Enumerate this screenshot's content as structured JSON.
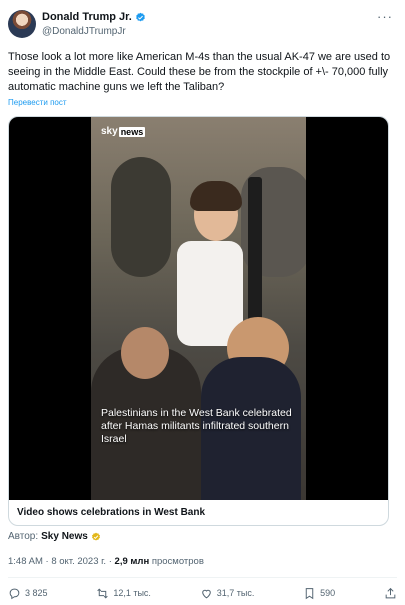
{
  "author": {
    "display_name": "Donald Trump Jr.",
    "handle": "@DonaldJTrumpJr"
  },
  "tweet": {
    "text": "Those look a lot more like American M-4s than the usual AK-47 we are used to seeing in the Middle East. Could these be from the stockpile of +\\- 70,000 fully automatic machine guns we left the Taliban?",
    "translate_label": "Перевести пост"
  },
  "video_card": {
    "logo_sky": "sky",
    "logo_news": "news",
    "caption": "Palestinians in the West Bank celebrated after Hamas militants infiltrated southern Israel",
    "title": "Video shows celebrations in West Bank"
  },
  "source": {
    "prefix": "Автор:",
    "name": "Sky News"
  },
  "meta": {
    "time": "1:48 AM",
    "separator": "·",
    "date": "8 окт. 2023 г.",
    "views": "2,9 млн",
    "views_label": "просмотров"
  },
  "actions": {
    "replies": "3 825",
    "reposts": "12,1 тыс.",
    "likes": "31,7 тыс.",
    "bookmarks": "590"
  },
  "colors": {
    "accent": "#1d9bf0",
    "text": "#0f1419",
    "muted": "#536471"
  }
}
